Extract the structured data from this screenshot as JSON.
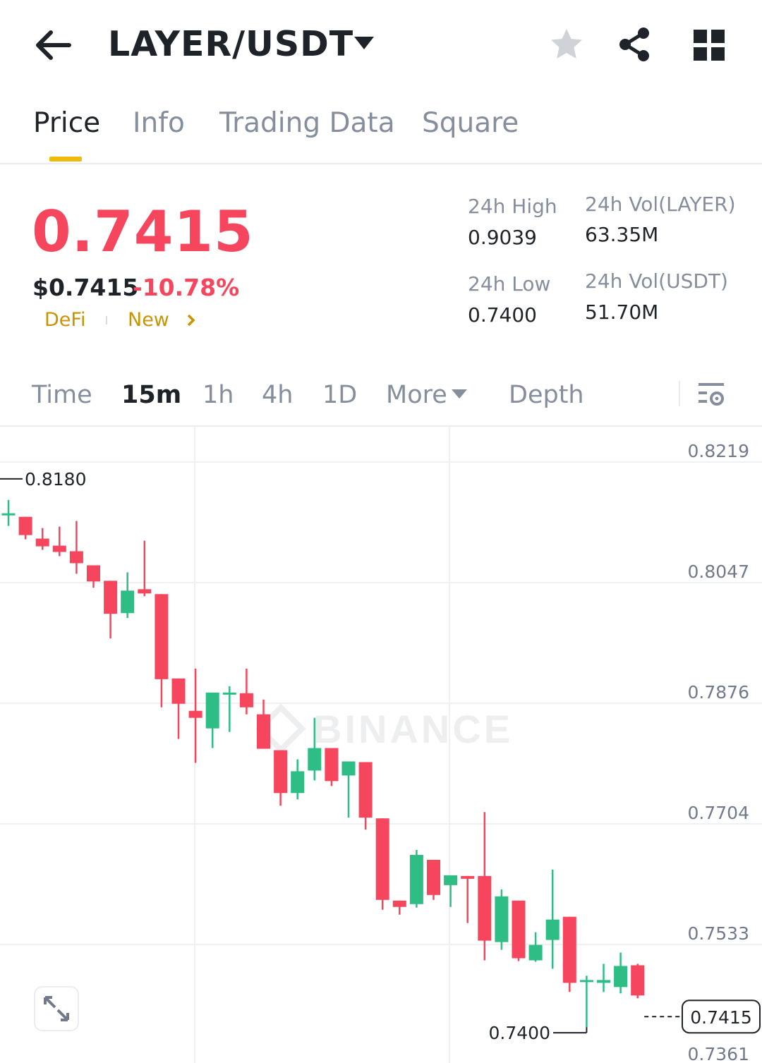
{
  "header": {
    "pair": "LAYER/USDT",
    "icons": [
      "back-arrow-icon",
      "caret-down-icon",
      "star-icon",
      "share-icon",
      "grid-icon"
    ]
  },
  "tabs": [
    {
      "label": "Price",
      "active": true
    },
    {
      "label": "Info",
      "active": false
    },
    {
      "label": "Trading Data",
      "active": false
    },
    {
      "label": "Square",
      "active": false
    }
  ],
  "ticker": {
    "last_price": "0.7415",
    "usd_price": "$0.7415",
    "change_pct": "-10.78%",
    "tags": [
      "DeFi",
      "New"
    ],
    "stats": {
      "high_label": "24h High",
      "high_value": "0.9039",
      "low_label": "24h Low",
      "low_value": "0.7400",
      "vol_base_label": "24h Vol(LAYER)",
      "vol_base_value": "63.35M",
      "vol_quote_label": "24h Vol(USDT)",
      "vol_quote_value": "51.70M"
    }
  },
  "intervals": {
    "items": [
      {
        "label": "Time",
        "active": false
      },
      {
        "label": "15m",
        "active": true
      },
      {
        "label": "1h",
        "active": false
      },
      {
        "label": "4h",
        "active": false
      },
      {
        "label": "1D",
        "active": false
      },
      {
        "label": "More",
        "active": false
      },
      {
        "label": "Depth",
        "active": false
      }
    ]
  },
  "colors": {
    "up": "#2ebd85",
    "down": "#f6465d",
    "accent": "#f0b90b"
  },
  "chart_data": {
    "type": "candlestick",
    "interval": "15m",
    "y_ticks": [
      "0.8219",
      "0.8047",
      "0.7876",
      "0.7704",
      "0.7533",
      "0.7361"
    ],
    "ylim": [
      0.7361,
      0.8219
    ],
    "watermark": "BINANCE",
    "annotations": {
      "high_marker": "0.8180",
      "low_marker": "0.7400",
      "last_price_label": "0.7415",
      "last_price": 0.7415
    },
    "candles": [
      {
        "o": 0.813,
        "h": 0.815,
        "l": 0.8113,
        "c": 0.8131
      },
      {
        "o": 0.8126,
        "h": 0.8126,
        "l": 0.8094,
        "c": 0.81
      },
      {
        "o": 0.8095,
        "h": 0.811,
        "l": 0.8079,
        "c": 0.8084
      },
      {
        "o": 0.8085,
        "h": 0.8112,
        "l": 0.807,
        "c": 0.8076
      },
      {
        "o": 0.8077,
        "h": 0.812,
        "l": 0.8045,
        "c": 0.806
      },
      {
        "o": 0.8057,
        "h": 0.8057,
        "l": 0.8025,
        "c": 0.8034
      },
      {
        "o": 0.8035,
        "h": 0.8035,
        "l": 0.7953,
        "c": 0.7988
      },
      {
        "o": 0.7989,
        "h": 0.8047,
        "l": 0.7982,
        "c": 0.8021
      },
      {
        "o": 0.8023,
        "h": 0.8092,
        "l": 0.8013,
        "c": 0.8017
      },
      {
        "o": 0.8016,
        "h": 0.8016,
        "l": 0.7855,
        "c": 0.7895
      },
      {
        "o": 0.7896,
        "h": 0.7896,
        "l": 0.781,
        "c": 0.786
      },
      {
        "o": 0.785,
        "h": 0.791,
        "l": 0.7776,
        "c": 0.784
      },
      {
        "o": 0.7825,
        "h": 0.7865,
        "l": 0.7797,
        "c": 0.7876
      },
      {
        "o": 0.7873,
        "h": 0.7885,
        "l": 0.782,
        "c": 0.7876
      },
      {
        "o": 0.7875,
        "h": 0.791,
        "l": 0.7845,
        "c": 0.7855
      },
      {
        "o": 0.7845,
        "h": 0.7866,
        "l": 0.7805,
        "c": 0.7796
      },
      {
        "o": 0.7794,
        "h": 0.7794,
        "l": 0.7715,
        "c": 0.7733
      },
      {
        "o": 0.7733,
        "h": 0.7781,
        "l": 0.7724,
        "c": 0.7764
      },
      {
        "o": 0.7765,
        "h": 0.784,
        "l": 0.7751,
        "c": 0.7797
      },
      {
        "o": 0.7797,
        "h": 0.7797,
        "l": 0.7743,
        "c": 0.775
      },
      {
        "o": 0.7758,
        "h": 0.7765,
        "l": 0.7698,
        "c": 0.7778
      },
      {
        "o": 0.7777,
        "h": 0.7777,
        "l": 0.7681,
        "c": 0.7698
      },
      {
        "o": 0.7697,
        "h": 0.7697,
        "l": 0.7567,
        "c": 0.7581
      },
      {
        "o": 0.758,
        "h": 0.758,
        "l": 0.756,
        "c": 0.7571
      },
      {
        "o": 0.7575,
        "h": 0.7652,
        "l": 0.757,
        "c": 0.7645
      },
      {
        "o": 0.7638,
        "h": 0.7638,
        "l": 0.7581,
        "c": 0.7588
      },
      {
        "o": 0.7602,
        "h": 0.7613,
        "l": 0.7571,
        "c": 0.7616
      },
      {
        "o": 0.7615,
        "h": 0.7615,
        "l": 0.7548,
        "c": 0.7611
      },
      {
        "o": 0.7615,
        "h": 0.7706,
        "l": 0.7495,
        "c": 0.7523
      },
      {
        "o": 0.7521,
        "h": 0.7596,
        "l": 0.751,
        "c": 0.7586
      },
      {
        "o": 0.758,
        "h": 0.758,
        "l": 0.7494,
        "c": 0.7498
      },
      {
        "o": 0.7495,
        "h": 0.7535,
        "l": 0.7493,
        "c": 0.7517
      },
      {
        "o": 0.7524,
        "h": 0.7624,
        "l": 0.7483,
        "c": 0.7553
      },
      {
        "o": 0.7557,
        "h": 0.7557,
        "l": 0.745,
        "c": 0.7463
      },
      {
        "o": 0.7467,
        "h": 0.7473,
        "l": 0.74,
        "c": 0.7467
      },
      {
        "o": 0.7463,
        "h": 0.749,
        "l": 0.745,
        "c": 0.7467
      },
      {
        "o": 0.7457,
        "h": 0.7506,
        "l": 0.7448,
        "c": 0.7487
      },
      {
        "o": 0.7488,
        "h": 0.749,
        "l": 0.7441,
        "c": 0.7445
      }
    ]
  }
}
